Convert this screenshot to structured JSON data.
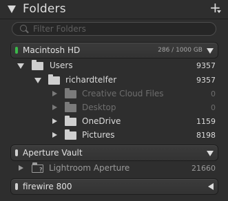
{
  "panel": {
    "title": "Folders",
    "add_symbol": "+",
    "filter": {
      "placeholder": "Filter Folders"
    }
  },
  "volumes": [
    {
      "name": "Macintosh HD",
      "size": "286 / 1000 GB",
      "led_color": "#3bb94a",
      "expanded": true,
      "folders": [
        {
          "label": "Users",
          "count": "9357",
          "state": "expanded"
        },
        {
          "label": "richardtelfer",
          "count": "9357",
          "state": "expanded"
        },
        {
          "label": "Creative Cloud Files",
          "count": "0",
          "state": "dim"
        },
        {
          "label": "Desktop",
          "count": "0",
          "state": "dim"
        },
        {
          "label": "OneDrive",
          "count": "1159",
          "state": "collapsed"
        },
        {
          "label": "Pictures",
          "count": "8198",
          "state": "collapsed"
        }
      ]
    },
    {
      "name": "Aperture Vault",
      "size": "",
      "led_color": "#d0d0d0",
      "expanded": true,
      "folders": [
        {
          "label": "Lightroom Aperture",
          "count": "21660",
          "state": "missing"
        }
      ]
    },
    {
      "name": "firewire 800",
      "size": "",
      "led_color": "#d0d0d0",
      "expanded": false,
      "folders": []
    }
  ]
}
